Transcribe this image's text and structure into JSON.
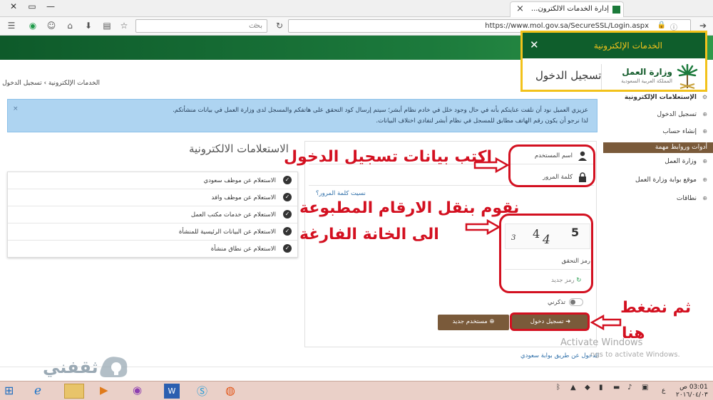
{
  "browser": {
    "tab_title": "إدارة الخدمات الالكترون...",
    "url": "https://www.mol.gov.sa/SecureSSL/Login.aspx",
    "search_placeholder": "بحث",
    "close_glyph": "×",
    "minimize_glyph": "—",
    "maximize_glyph": "▭",
    "window_close_glyph": "✕"
  },
  "header": {
    "eservices_title": "الخدمات الإلكترونية",
    "brand_name": "وزارة العمل",
    "brand_sub": "المملكة العربية السعودية",
    "login_title": "تسجيل الدخول"
  },
  "breadcrumb": "الخدمات الإلكترونية › تسجيل الدخول",
  "alert": {
    "line1": "عزيزي العميل نود أن نلفت عنايتكم بأنه في حال وجود خلل في خادم نظام أبشر؛ سيتم إرسال كود التحقق على هاتفكم والمسجل لدى وزارة العمل في بيانات منشأتكم.",
    "line2": "لذا نرجو أن يكون رقم الهاتف مطابق للمسجل في نظام أبشر لتفادي اختلاف البيانات.",
    "close": "×"
  },
  "sidebar": {
    "section1": "الإستعلامات الإلكترونية",
    "items1": [
      "تسجيل الدخول",
      "إنشاء حساب"
    ],
    "section2": "أدوات وروابط مهمة",
    "items2": [
      "وزارة العمل",
      "موقع بوابة وزارة العمل",
      "نطاقات"
    ]
  },
  "login": {
    "username_label": "اسم المستخدم",
    "password_label": "كلمة المرور",
    "forgot": "نسيت كلمة المرور؟",
    "captcha_digits": [
      "3",
      "4",
      "4",
      "5"
    ],
    "verify_label": "رمز التحقق",
    "refresh": "رمز جديد",
    "remember": "تذكرني",
    "login_button": "تسجيل دخول",
    "new_user_button": "مستخدم جديد",
    "absher_link": "الدخول عن طريق بوابة سعودي"
  },
  "inquiries": {
    "title": "الاستعلامات الالكترونية",
    "items": [
      "الاستعلام عن موظف سعودي",
      "الاستعلام عن موظف وافد",
      "الاستعلام عن خدمات مكتب العمل",
      "الاستعلام عن البيانات الرئيسية للمنشأة",
      "الاستعلام عن نطاق منشأة"
    ]
  },
  "annotations": {
    "step1": "اكتب بيانات تسجيل الدخول",
    "step2_line1": "نقوم بنقل الارقام المطبوعة",
    "step2_line2": "الى الخانة الفارغة",
    "step3_line1": "ثم نضغط",
    "step3_line2": "هنا",
    "color": "#d31020",
    "highlight_color": "#f2c21b"
  },
  "watermark": {
    "line1": "Activate Windows",
    "line2": "ngs to activate Windows.",
    "brand": "ثقفني"
  },
  "taskbar": {
    "time": "03:01 ص",
    "date": "٢٠١٦/٠٤/٠٣",
    "lang": "ع"
  }
}
